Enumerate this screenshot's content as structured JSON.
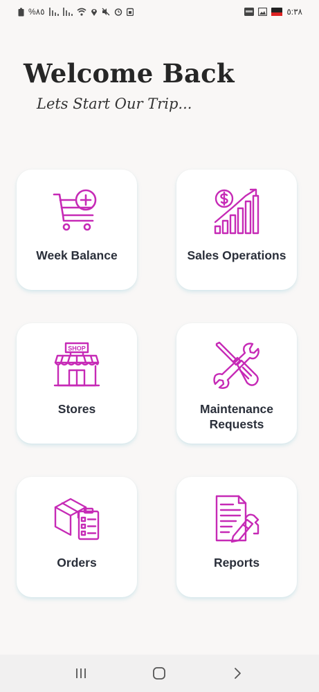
{
  "status_bar": {
    "battery_text": "%٨٥",
    "time": "٥:٣٨",
    "icons_left": [
      "battery-icon",
      "signal-icon",
      "signal-icon",
      "wifi-icon",
      "location-icon",
      "mute-icon",
      "alarm-icon",
      "notification-icon"
    ],
    "icons_right": [
      "app-notification-icon",
      "gallery-icon",
      "app-badge-icon"
    ]
  },
  "header": {
    "title": "Welcome Back",
    "subtitle": "Lets Start Our Trip..."
  },
  "accent_color": "#c62ab6",
  "cards": [
    {
      "label": "Week Balance",
      "icon": "cart-add-icon"
    },
    {
      "label": "Sales Operations",
      "icon": "sales-growth-icon"
    },
    {
      "label": "Stores",
      "icon": "shop-icon"
    },
    {
      "label": "Maintenance Requests",
      "icon": "tools-icon"
    },
    {
      "label": "Orders",
      "icon": "orders-box-icon"
    },
    {
      "label": "Reports",
      "icon": "report-icon"
    }
  ],
  "nav": {
    "buttons": [
      "recent-apps-icon",
      "home-icon",
      "back-icon"
    ]
  }
}
